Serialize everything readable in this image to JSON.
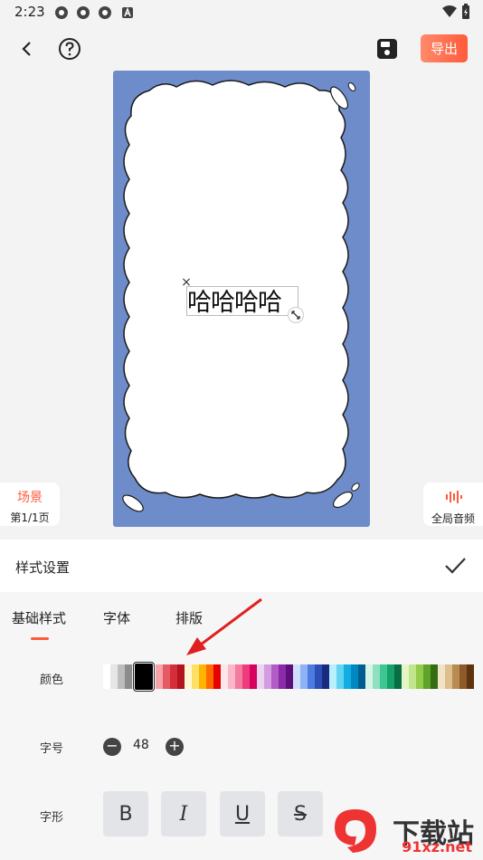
{
  "status": {
    "time": "2:23"
  },
  "toolbar": {
    "export_label": "导出"
  },
  "canvas": {
    "text": "哈哈哈哈",
    "background": "#6e8cc9"
  },
  "scene": {
    "title": "场景",
    "page": "第1/1页"
  },
  "audio": {
    "label": "全局音频"
  },
  "panel": {
    "title": "样式设置"
  },
  "tabs": [
    {
      "label": "基础样式"
    },
    {
      "label": "字体"
    },
    {
      "label": "排版"
    }
  ],
  "color_row": {
    "label": "颜色",
    "swatches": [
      "#ffffff",
      "#e6e6e6",
      "#bdbdbd",
      "#8c8c8c",
      "#000000",
      "#f5a3a8",
      "#e55b64",
      "#d62d3a",
      "#b3121f",
      "#fff7d6",
      "#ffe066",
      "#ffb400",
      "#ff6a00",
      "#e60000",
      "#fde7ec",
      "#f9b7c9",
      "#f47ba0",
      "#ee3b7c",
      "#d6005e",
      "#ead4ef",
      "#d49be0",
      "#b25dc7",
      "#8a2aa6",
      "#5d107a",
      "#cfe0ff",
      "#8eb3f5",
      "#4e7be0",
      "#2a4fb5",
      "#1a2a80",
      "#b9f0ff",
      "#62d4f2",
      "#12aee0",
      "#0088c2",
      "#005f8f",
      "#d6f5e8",
      "#8fe0c0",
      "#3cc794",
      "#16a06a",
      "#0a6e45",
      "#e5f5c8",
      "#c1e58a",
      "#93cc4a",
      "#5fa328",
      "#356e10",
      "#f2e3c8",
      "#dcbf8c",
      "#b98a52",
      "#8f5a2a",
      "#5f3210"
    ],
    "selected": "#000000"
  },
  "size_row": {
    "label": "字号",
    "value": "48"
  },
  "shape_row": {
    "label": "字形",
    "bold": "B",
    "italic": "I",
    "underline": "U",
    "strike": "S"
  },
  "watermark": {
    "brand": "下载站",
    "url": "91xz.net",
    "logo": "91"
  }
}
